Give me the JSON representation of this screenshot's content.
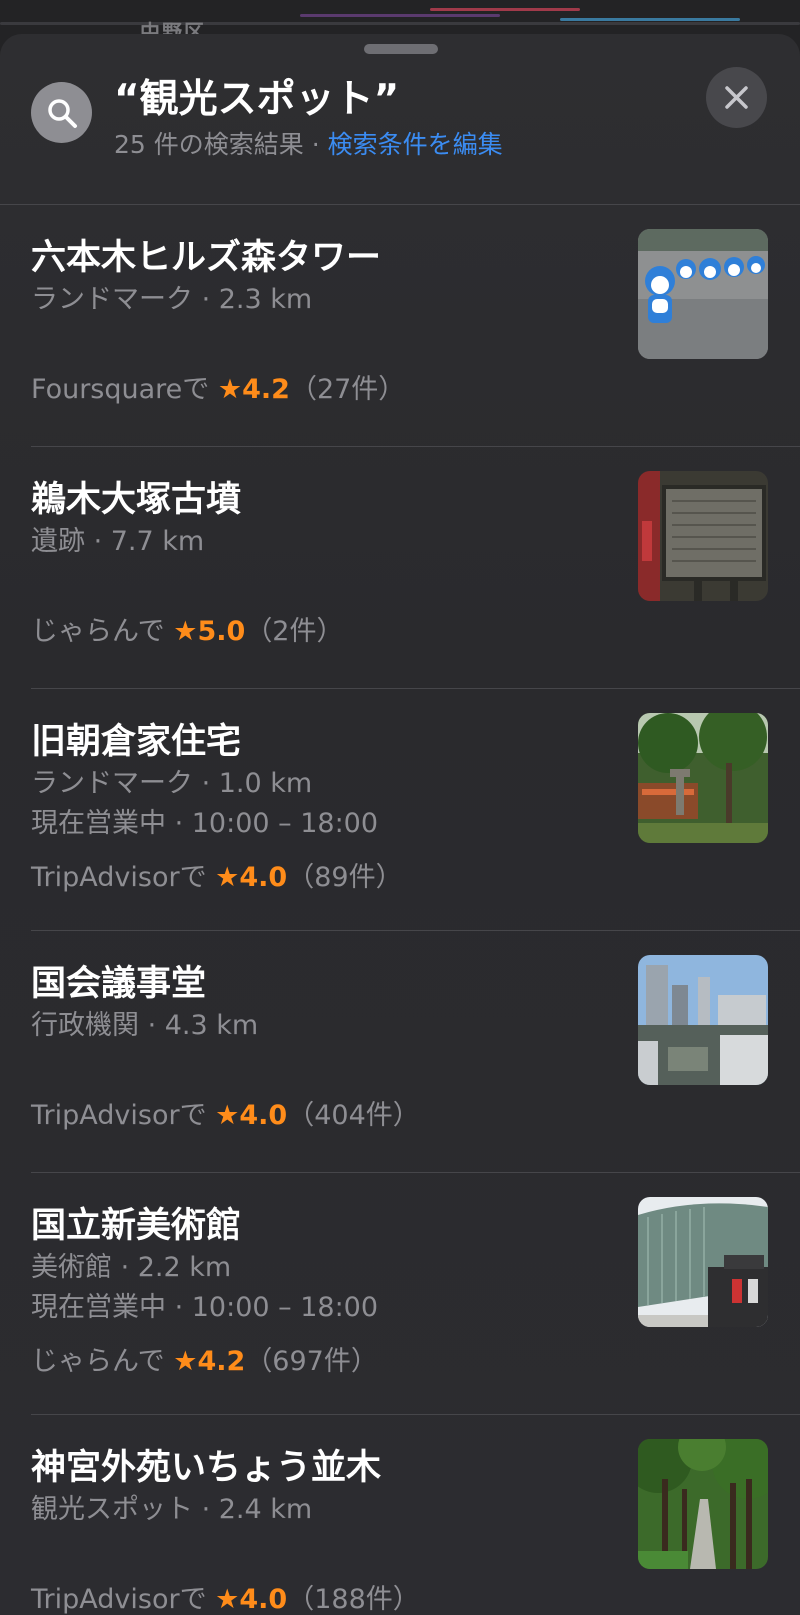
{
  "map": {
    "district_label": "中野区"
  },
  "header": {
    "title": "“観光スポット”",
    "result_count": "25 件の検索結果",
    "separator": "·",
    "edit_link": "検索条件を編集"
  },
  "icons": {
    "search": "search-icon",
    "close": "close-icon",
    "star": "star-icon"
  },
  "colors": {
    "accent_blue": "#3b8cf2",
    "star_orange": "#ff8c1a"
  },
  "results": [
    {
      "name": "六本木ヒルズ森タワー",
      "meta_lines": [
        "ランドマーク · 2.3 km"
      ],
      "rating_source": "Foursquareで",
      "star": "★",
      "score": "4.2",
      "reviews": "（27件）"
    },
    {
      "name": "鵜木大塚古墳",
      "meta_lines": [
        "遺跡 · 7.7 km"
      ],
      "rating_source": "じゃらんで",
      "star": "★",
      "score": "5.0",
      "reviews": "（2件）"
    },
    {
      "name": "旧朝倉家住宅",
      "meta_lines": [
        "ランドマーク · 1.0 km",
        "現在営業中 · 10:00 – 18:00"
      ],
      "rating_source": "TripAdvisorで",
      "star": "★",
      "score": "4.0",
      "reviews": "（89件）"
    },
    {
      "name": "国会議事堂",
      "meta_lines": [
        "行政機関 · 4.3 km"
      ],
      "rating_source": "TripAdvisorで",
      "star": "★",
      "score": "4.0",
      "reviews": "（404件）"
    },
    {
      "name": "国立新美術館",
      "meta_lines": [
        "美術館 · 2.2 km",
        "現在営業中 · 10:00 – 18:00"
      ],
      "rating_source": "じゃらんで",
      "star": "★",
      "score": "4.2",
      "reviews": "（697件）"
    },
    {
      "name": "神宮外苑いちょう並木",
      "meta_lines": [
        "観光スポット · 2.4 km"
      ],
      "rating_source": "TripAdvisorで",
      "star": "★",
      "score": "4.0",
      "reviews": "（188件）"
    }
  ]
}
